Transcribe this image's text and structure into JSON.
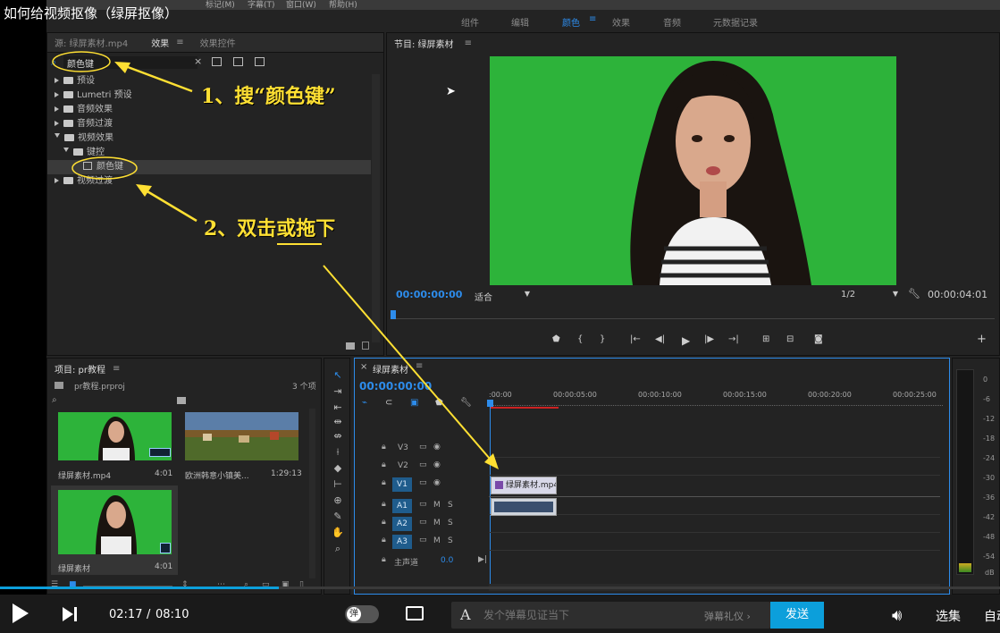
{
  "video_title": "如何给视频抠像（绿屏抠像）",
  "menubar": {
    "items_partial": [
      "标记(M)",
      "字幕(T)",
      "窗口(W)",
      "帮助(H)"
    ]
  },
  "workspace_tabs": [
    "组件",
    "编辑",
    "颜色",
    "效果",
    "音频",
    "元数据记录"
  ],
  "workspace_active": "颜色",
  "effects_panel": {
    "tabs": [
      "源: 绿屏素材.mp4",
      "效果",
      "效果控件"
    ],
    "search_value": "颜色键",
    "tree": [
      {
        "label": "预设",
        "level": 0,
        "expanded": false
      },
      {
        "label": "Lumetri 预设",
        "level": 0,
        "expanded": false
      },
      {
        "label": "音频效果",
        "level": 0,
        "expanded": false
      },
      {
        "label": "音频过渡",
        "level": 0,
        "expanded": false
      },
      {
        "label": "视频效果",
        "level": 0,
        "expanded": true
      },
      {
        "label": "键控",
        "level": 1,
        "expanded": true
      },
      {
        "label": "颜色键",
        "level": 2,
        "selected": true
      },
      {
        "label": "视频过渡",
        "level": 0,
        "expanded": false
      }
    ]
  },
  "program_monitor": {
    "title": "节目: 绿屏素材",
    "timecode": "00:00:00:00",
    "fit": "适合",
    "resolution": "1/2",
    "duration": "00:00:04:01"
  },
  "project_panel": {
    "title": "项目: pr教程",
    "file": "pr教程.prproj",
    "count": "3 个项",
    "items": [
      {
        "name": "绿屏素材.mp4",
        "duration": "4:01",
        "thumb": "green"
      },
      {
        "name": "欧洲韩意小镇美...",
        "duration": "1:29:13",
        "thumb": "town"
      },
      {
        "name": "绿屏素材",
        "duration": "4:01",
        "thumb": "green"
      }
    ]
  },
  "timeline": {
    "title": "绿屏素材",
    "timecode": "00:00:00:00",
    "ruler": [
      ":00:00",
      "00:00:05:00",
      "00:00:10:00",
      "00:00:15:00",
      "00:00:20:00",
      "00:00:25:00"
    ],
    "tracks": [
      "V3",
      "V2",
      "V1",
      "A1",
      "A2",
      "A3"
    ],
    "master": "主声道",
    "master_value": "0.0",
    "clip_video": "绿屏素材.mp4"
  },
  "meter_scale": [
    "0",
    "-6",
    "-12",
    "-18",
    "-24",
    "-30",
    "-36",
    "-42",
    "-48",
    "-54",
    "dB"
  ],
  "meter_bottom": [
    "S",
    "S"
  ],
  "annotations": {
    "step1": "1、搜“颜色键”",
    "step2": "2、双击或拖下"
  },
  "player": {
    "current": "02:17",
    "separator": "/",
    "total": "08:10",
    "danmaku_label": "弹",
    "danmaku_placeholder": "发个弹幕见证当下",
    "danmaku_etiquette": "弹幕礼仪 ›",
    "send": "发送",
    "select": "选集",
    "auto": "自动",
    "progress": 0.279
  },
  "colors": {
    "green_screen": "#2db33a",
    "accent": "#2d8ceb",
    "annotation": "#ffe033",
    "send_button": "#0c9fdb"
  }
}
